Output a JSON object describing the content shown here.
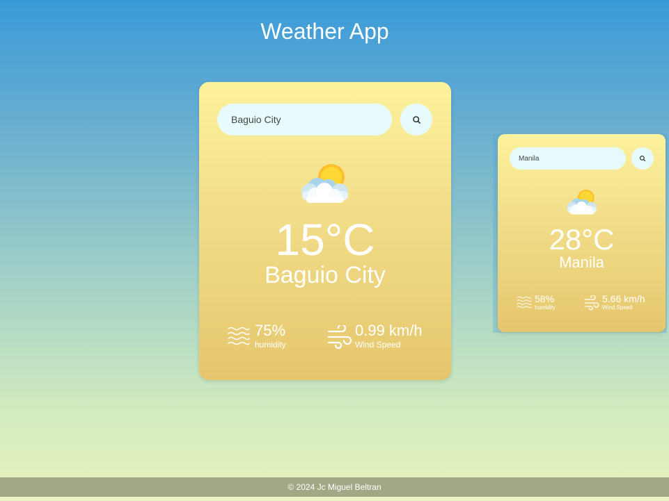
{
  "app": {
    "title": "Weather App"
  },
  "cards": [
    {
      "search": {
        "value": "Baguio City"
      },
      "icon": "partly-cloudy-icon",
      "temperature": "15°C",
      "city": "Baguio City",
      "humidity": {
        "value": "75%",
        "label": "humidity",
        "icon": "waves-icon"
      },
      "wind": {
        "value": "0.99 km/h",
        "label": "Wind Speed",
        "icon": "wind-icon"
      }
    },
    {
      "search": {
        "value": "Manila"
      },
      "icon": "partly-cloudy-icon",
      "temperature": "28°C",
      "city": "Manila",
      "humidity": {
        "value": "58%",
        "label": "humidity",
        "icon": "waves-icon"
      },
      "wind": {
        "value": "5.66 km/h",
        "label": "Wind Speed",
        "icon": "wind-icon"
      }
    }
  ],
  "footer": {
    "text": "© 2024 Jc Miguel Beltran"
  },
  "colors": {
    "card_top": "#fdf29d",
    "card_bottom": "#e5c66d",
    "input_bg": "#e7fbfc",
    "footer_bg": "#a2a885"
  }
}
